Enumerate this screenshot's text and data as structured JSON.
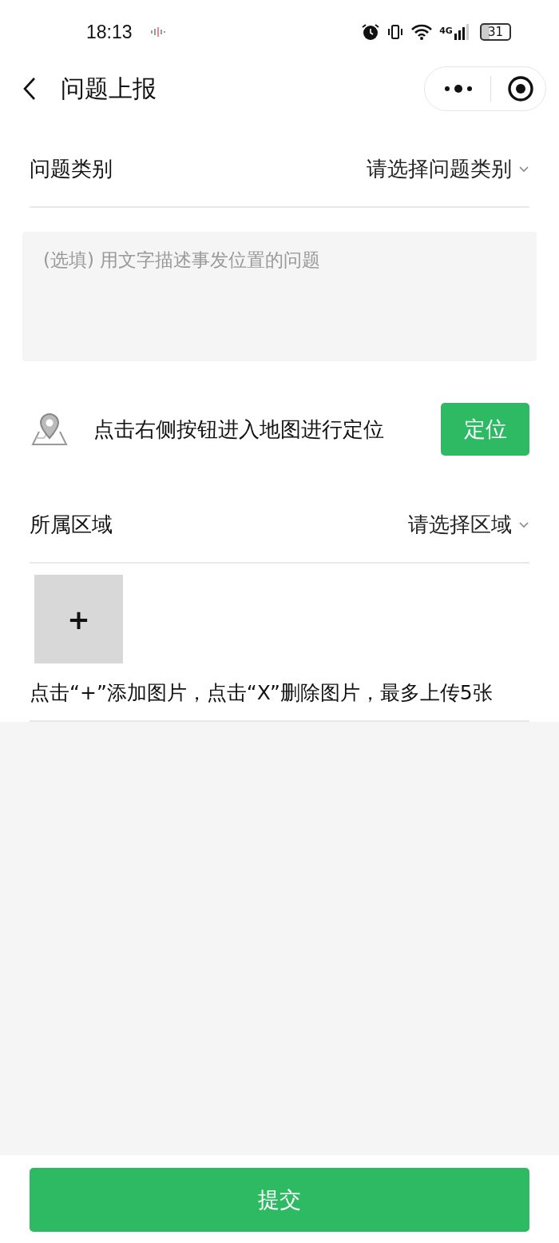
{
  "status_bar": {
    "time": "18:13",
    "network": "4G",
    "battery": "31"
  },
  "header": {
    "title": "问题上报"
  },
  "category": {
    "label": "问题类别",
    "placeholder": "请选择问题类别"
  },
  "description": {
    "placeholder": "(选填) 用文字描述事发位置的问题"
  },
  "location": {
    "hint": "点击右侧按钮进入地图进行定位",
    "button": "定位"
  },
  "region": {
    "label": "所属区域",
    "placeholder": "请选择区域"
  },
  "upload": {
    "add": "+",
    "hint": "点击“+”添加图片，点击“X”删除图片，最多上传5张"
  },
  "submit": "提交"
}
